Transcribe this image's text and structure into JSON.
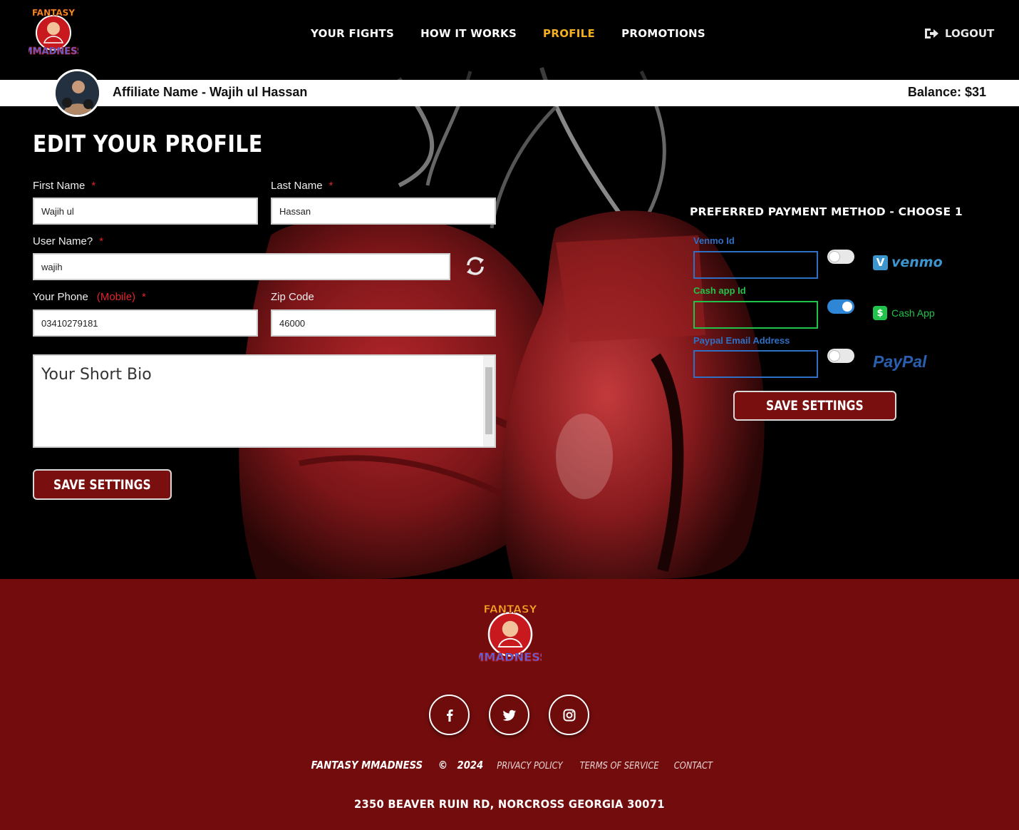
{
  "header": {
    "logo_text_top": "FANTASY",
    "logo_text_bottom": "MMADNESS",
    "nav": [
      {
        "label": "YOUR FIGHTS",
        "active": false
      },
      {
        "label": "HOW IT WORKS",
        "active": false
      },
      {
        "label": "PROFILE",
        "active": true
      },
      {
        "label": "PROMOTIONS",
        "active": false
      }
    ],
    "logout_label": "LOGOUT",
    "active_color": "#f5b021"
  },
  "affiliate": {
    "name": "Affiliate Name - Wajih ul Hassan",
    "balance": "Balance: $31"
  },
  "profile": {
    "title": "EDIT YOUR PROFILE",
    "first_name": {
      "label": "First Name",
      "value": "Wajih ul",
      "required_mark": "*"
    },
    "last_name": {
      "label": "Last Name",
      "value": "Hassan",
      "required_mark": "*"
    },
    "user_name": {
      "label": "User Name?",
      "value": "wajih",
      "required_mark": "*"
    },
    "phone": {
      "label": "Your Phone",
      "hint": "(Mobile)",
      "value": "03410279181",
      "required_mark": "*"
    },
    "zip": {
      "label": "Zip Code",
      "value": "46000"
    },
    "bio": {
      "placeholder": "Your Short Bio"
    },
    "save_label": "SAVE SETTINGS"
  },
  "payment": {
    "title": "PREFERRED PAYMENT METHOD - CHOOSE 1",
    "methods": [
      {
        "label": "Venmo Id",
        "value": "",
        "enabled": false,
        "color": "#2f6fc4",
        "brand": "venmo",
        "brand_mark": "V"
      },
      {
        "label": "Cash app Id",
        "value": "",
        "enabled": true,
        "color": "#22c34a",
        "brand": "Cash App",
        "brand_mark": "$"
      },
      {
        "label": "Paypal Email Address",
        "value": "",
        "enabled": false,
        "color": "#2f6fc4",
        "brand": "PayPal"
      }
    ],
    "save_label": "SAVE SETTINGS"
  },
  "footer": {
    "brand": "FANTASY MMADNESS",
    "copyright": "©",
    "year": "2024",
    "links": [
      "PRIVACY POLICY",
      "TERMS OF SERVICE",
      "CONTACT"
    ],
    "address": "2350 BEAVER RUIN RD, NORCROSS GEORGIA 30071",
    "social": [
      "facebook-icon",
      "twitter-icon",
      "instagram-icon"
    ],
    "bg_color": "#730d0d"
  }
}
